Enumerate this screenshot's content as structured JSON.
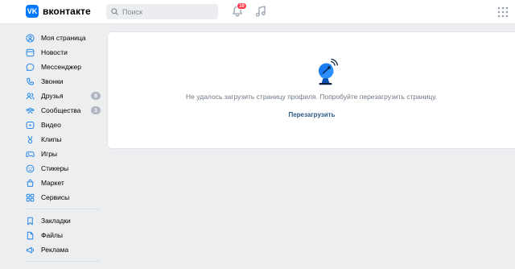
{
  "header": {
    "brand": "вконтакте",
    "logo_glyph": "VK",
    "search_placeholder": "Поиск",
    "notifications_count": "10"
  },
  "sidebar": {
    "items": [
      {
        "label": "Моя страница",
        "icon": "profile-icon"
      },
      {
        "label": "Новости",
        "icon": "news-icon"
      },
      {
        "label": "Мессенджер",
        "icon": "messenger-icon"
      },
      {
        "label": "Звонки",
        "icon": "phone-icon"
      },
      {
        "label": "Друзья",
        "icon": "friends-icon",
        "badge": "8"
      },
      {
        "label": "Сообщества",
        "icon": "communities-icon",
        "badge": "3"
      },
      {
        "label": "Видео",
        "icon": "video-icon"
      },
      {
        "label": "Клипы",
        "icon": "clips-icon"
      },
      {
        "label": "Игры",
        "icon": "games-icon"
      },
      {
        "label": "Стикеры",
        "icon": "stickers-icon"
      },
      {
        "label": "Маркет",
        "icon": "market-icon"
      },
      {
        "label": "Сервисы",
        "icon": "services-icon"
      }
    ],
    "secondary_items": [
      {
        "label": "Закладки",
        "icon": "bookmarks-icon"
      },
      {
        "label": "Файлы",
        "icon": "files-icon"
      },
      {
        "label": "Реклама",
        "icon": "ads-icon"
      }
    ]
  },
  "main": {
    "error_message": "Не удалось загрузить страницу профиля. Попробуйте перезагрузить страницу.",
    "reload_label": "Перезагрузить"
  },
  "colors": {
    "accent": "#0077ff",
    "icon": "#2688eb",
    "badge": "#aeb7c2",
    "notification": "#ff3347",
    "link": "#2a5885"
  }
}
